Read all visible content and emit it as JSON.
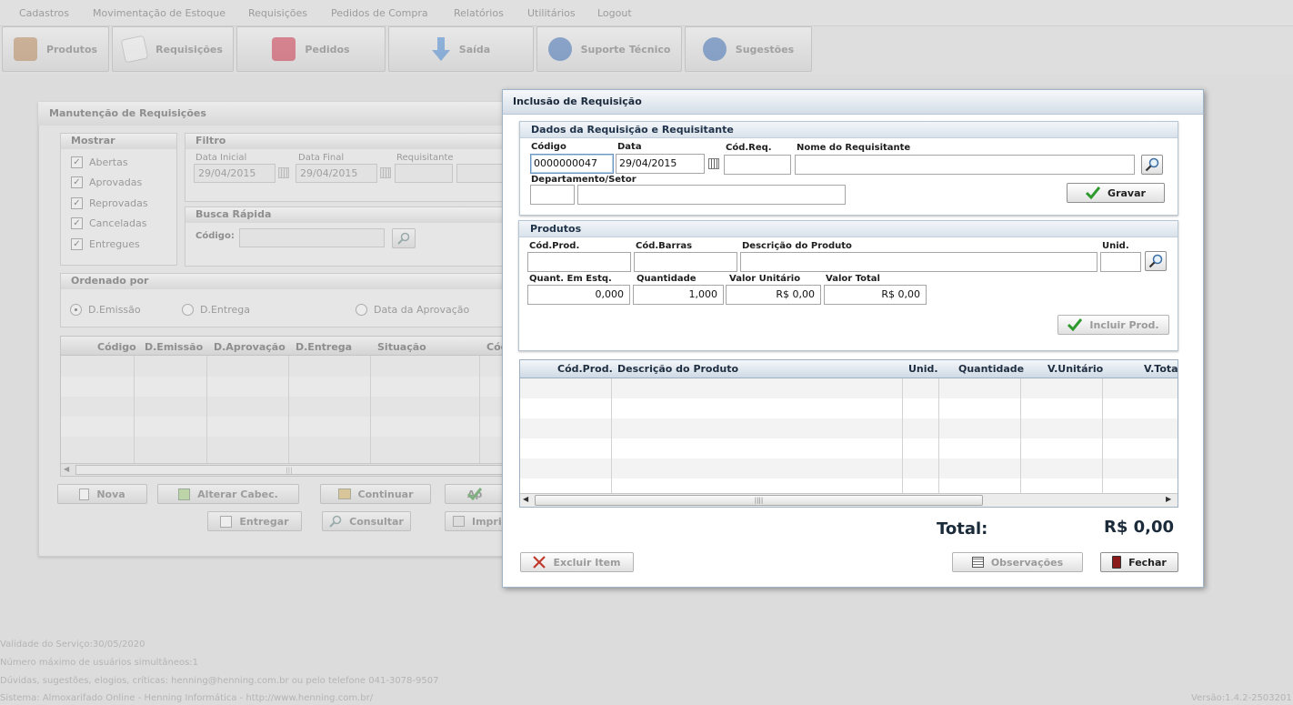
{
  "menu": {
    "items": [
      "Cadastros",
      "Movimentação de Estoque",
      "Requisições",
      "Pedidos de Compra",
      "Relatórios",
      "Utilitários",
      "Logout"
    ]
  },
  "toolbar": {
    "buttons": [
      {
        "label": "Produtos",
        "icon": "book-icon"
      },
      {
        "label": "Requisições",
        "icon": "document-icon"
      },
      {
        "label": "Pedidos",
        "icon": "folder-icon"
      },
      {
        "label": "Saída",
        "icon": "arrow-down-icon"
      },
      {
        "label": "Suporte Técnico",
        "icon": "help-icon"
      },
      {
        "label": "Sugestões",
        "icon": "info-icon"
      }
    ]
  },
  "background_panel": {
    "title": "Manutenção de Requisições",
    "mostrar": {
      "title": "Mostrar",
      "options": [
        {
          "label": "Abertas",
          "checked": true
        },
        {
          "label": "Aprovadas",
          "checked": true
        },
        {
          "label": "Reprovadas",
          "checked": true
        },
        {
          "label": "Canceladas",
          "checked": true
        },
        {
          "label": "Entregues",
          "checked": true
        }
      ]
    },
    "filtro": {
      "title": "Filtro",
      "data_inicial_label": "Data Inicial",
      "data_inicial_value": "29/04/2015",
      "data_final_label": "Data Final",
      "data_final_value": "29/04/2015",
      "requisitante_label": "Requisitante"
    },
    "busca": {
      "title": "Busca Rápida",
      "codigo_label": "Código:"
    },
    "ordenado": {
      "title": "Ordenado por",
      "options": [
        {
          "label": "D.Emissão",
          "selected": true
        },
        {
          "label": "D.Entrega",
          "selected": false
        },
        {
          "label": "Data da Aprovação",
          "selected": false
        }
      ]
    },
    "table_headers": [
      "Código",
      "D.Emissão",
      "D.Aprovação",
      "D.Entrega",
      "Situação",
      "Cód"
    ],
    "scroll_grip": "|||",
    "buttons": {
      "nova": "Nova",
      "alterar": "Alterar Cabec.",
      "continuar": "Continuar",
      "aprovar": "Ap",
      "entregar": "Entregar",
      "consultar": "Consultar",
      "imprimir": "Impri"
    }
  },
  "footer": {
    "validade": "Validade do Serviço:30/05/2020",
    "usuarios": "Número máximo de usuários simultâneos:1",
    "duvidas": "Dúvidas, sugestões, elogios, críticas: henning@henning.com.br ou pelo telefone 041-3078-9507",
    "sistema": "Sistema: Almoxarifado Online - Henning Informática - http://www.henning.com.br/",
    "versao": "Versão:1.4.2-2503201"
  },
  "modal": {
    "title": "Inclusão de Requisição",
    "dados": {
      "title": "Dados da Requisição e Requisitante",
      "codigo_label": "Código",
      "codigo_value": "0000000047",
      "data_label": "Data",
      "data_value": "29/04/2015",
      "cod_req_label": "Cód.Req.",
      "cod_req_value": "",
      "nome_label": "Nome do Requisitante",
      "nome_value": "",
      "depto_label": "Departamento/Setor",
      "depto_code": "",
      "depto_name": "",
      "gravar_label": "Gravar"
    },
    "produtos": {
      "title": "Produtos",
      "cod_prod_label": "Cód.Prod.",
      "cod_barras_label": "Cód.Barras",
      "descricao_label": "Descrição do Produto",
      "unid_label": "Unid.",
      "quant_estq_label": "Quant. Em Estq.",
      "quant_estq_value": "0,000",
      "quantidade_label": "Quantidade",
      "quantidade_value": "1,000",
      "valor_unit_label": "Valor Unitário",
      "valor_unit_value": "R$ 0,00",
      "valor_total_label": "Valor Total",
      "valor_total_value": "R$ 0,00",
      "incluir_label": "Incluir Prod."
    },
    "grid": {
      "headers": [
        "Cód.Prod.",
        "Descrição do Produto",
        "Unid.",
        "Quantidade",
        "V.Unitário",
        "V.Tota"
      ],
      "scroll_grip": "||||"
    },
    "total_label": "Total:",
    "total_value": "R$ 0,00",
    "excluir_label": "Excluir Item",
    "observacoes_label": "Observações",
    "fechar_label": "Fechar"
  },
  "colors": {
    "background": "#dcdcdc",
    "modal_header": "#d4dde7",
    "check_green": "#2e9a2e",
    "delete_red": "#c0392b"
  }
}
